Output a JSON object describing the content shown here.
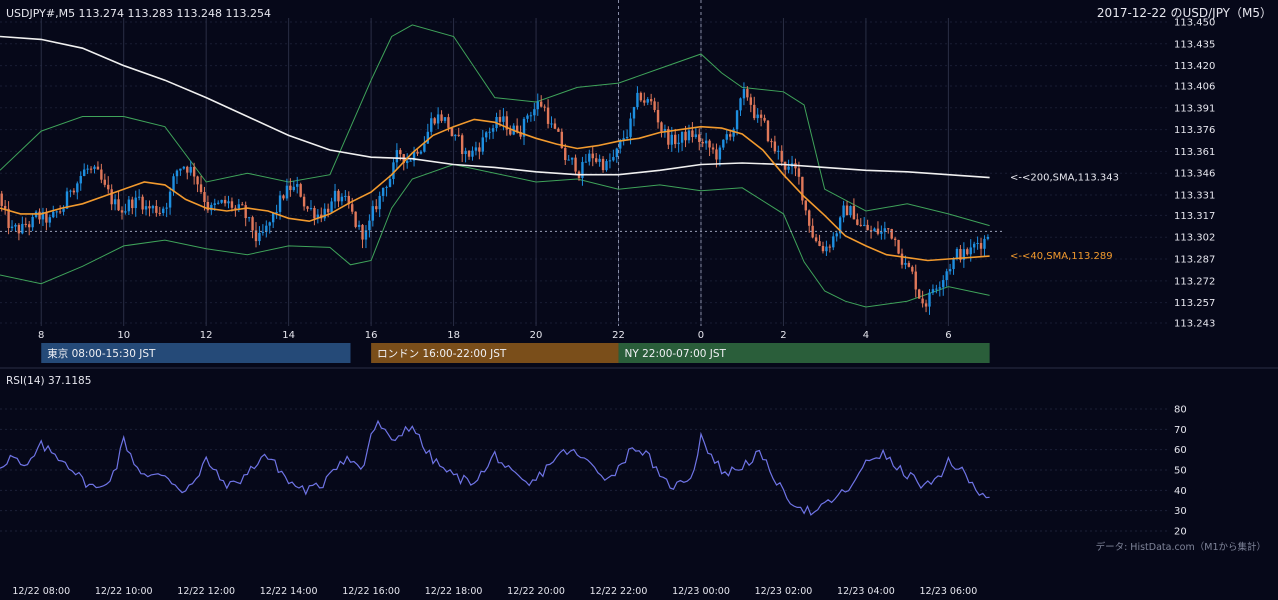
{
  "header": {
    "symbol_line": "USDJPY#,M5 113.274 113.283 113.248 113.254",
    "title": "2017-12-22 のUSD/JPY（M5）"
  },
  "sessions": [
    {
      "label": "東京 08:00-15:30 JST",
      "start_hour": 8,
      "end_hour": 15.5,
      "color": "#254a78"
    },
    {
      "label": "ロンドン 16:00-22:00 JST",
      "start_hour": 16,
      "end_hour": 22,
      "color": "#7a4e1a"
    },
    {
      "label": "NY 22:00-07:00 JST",
      "start_hour": 22,
      "end_hour": 31,
      "color": "#2a5e3a"
    }
  ],
  "rsi_panel": {
    "title": "RSI(14) 37.1185"
  },
  "source_note": "データ: HistData.com（M1から集計）",
  "colors": {
    "background": "#060819",
    "candle_up": "#1e8fe0",
    "candle_down": "#e0785a",
    "sma200": "#f0f0f0",
    "sma40": "#f29a2e",
    "bollinger": "#3fa35a",
    "rsi": "#6f74e6"
  },
  "chart_data": [
    {
      "type": "candlestick",
      "ylim": [
        113.243,
        113.45
      ],
      "y_ticks": [
        "113.450",
        "113.435",
        "113.420",
        "113.406",
        "113.391",
        "113.376",
        "113.361",
        "113.346",
        "113.331",
        "113.317",
        "113.302",
        "113.287",
        "113.272",
        "113.257",
        "113.243"
      ],
      "x_ticks": [
        "8",
        "10",
        "12",
        "14",
        "16",
        "18",
        "20",
        "22",
        "0",
        "2",
        "4",
        "6"
      ],
      "x_tick_hours": [
        8,
        10,
        12,
        14,
        16,
        18,
        20,
        22,
        24,
        26,
        28,
        30
      ],
      "x_range_hours": [
        7,
        31.3
      ],
      "last_close": 113.254,
      "series": [
        {
          "name": "200,SMA",
          "label": "<-<200,SMA,113.343",
          "last": 113.343,
          "points": [
            [
              7,
              113.44
            ],
            [
              8,
              113.438
            ],
            [
              9,
              113.432
            ],
            [
              10,
              113.42
            ],
            [
              11,
              113.41
            ],
            [
              12,
              113.398
            ],
            [
              13,
              113.385
            ],
            [
              14,
              113.372
            ],
            [
              15,
              113.362
            ],
            [
              16,
              113.357
            ],
            [
              17,
              113.356
            ],
            [
              18,
              113.352
            ],
            [
              19,
              113.35
            ],
            [
              20,
              113.347
            ],
            [
              21,
              113.345
            ],
            [
              22,
              113.345
            ],
            [
              23,
              113.348
            ],
            [
              24,
              113.352
            ],
            [
              25,
              113.353
            ],
            [
              26,
              113.352
            ],
            [
              27,
              113.35
            ],
            [
              28,
              113.348
            ],
            [
              29,
              113.347
            ],
            [
              30,
              113.345
            ],
            [
              31,
              113.343
            ]
          ]
        },
        {
          "name": "40,SMA",
          "label": "<-<40,SMA,113.289",
          "last": 113.289,
          "points": [
            [
              7,
              113.322
            ],
            [
              7.5,
              113.318
            ],
            [
              8,
              113.318
            ],
            [
              8.5,
              113.322
            ],
            [
              9,
              113.325
            ],
            [
              9.5,
              113.33
            ],
            [
              10,
              113.335
            ],
            [
              10.5,
              113.34
            ],
            [
              11,
              113.338
            ],
            [
              11.5,
              113.328
            ],
            [
              12,
              113.322
            ],
            [
              12.5,
              113.32
            ],
            [
              13,
              113.322
            ],
            [
              13.5,
              113.32
            ],
            [
              14,
              113.315
            ],
            [
              14.5,
              113.313
            ],
            [
              15,
              113.318
            ],
            [
              15.5,
              113.326
            ],
            [
              16,
              113.333
            ],
            [
              16.5,
              113.345
            ],
            [
              17,
              113.36
            ],
            [
              17.5,
              113.372
            ],
            [
              18,
              113.378
            ],
            [
              18.5,
              113.383
            ],
            [
              19,
              113.381
            ],
            [
              19.5,
              113.375
            ],
            [
              20,
              113.37
            ],
            [
              20.5,
              113.366
            ],
            [
              21,
              113.363
            ],
            [
              21.5,
              113.365
            ],
            [
              22,
              113.368
            ],
            [
              22.5,
              113.37
            ],
            [
              23,
              113.374
            ],
            [
              23.5,
              113.376
            ],
            [
              24,
              113.378
            ],
            [
              24.5,
              113.377
            ],
            [
              25,
              113.373
            ],
            [
              25.5,
              113.362
            ],
            [
              26,
              113.345
            ],
            [
              26.5,
              113.33
            ],
            [
              27,
              113.317
            ],
            [
              27.5,
              113.303
            ],
            [
              28,
              113.296
            ],
            [
              28.5,
              113.29
            ],
            [
              29,
              113.288
            ],
            [
              29.5,
              113.286
            ],
            [
              30,
              113.287
            ],
            [
              30.5,
              113.288
            ],
            [
              31,
              113.289
            ]
          ]
        },
        {
          "name": "Bollinger upper",
          "points": [
            [
              7,
              113.348
            ],
            [
              8,
              113.375
            ],
            [
              9,
              113.385
            ],
            [
              10,
              113.385
            ],
            [
              11,
              113.378
            ],
            [
              12,
              113.34
            ],
            [
              13,
              113.346
            ],
            [
              14,
              113.34
            ],
            [
              15,
              113.345
            ],
            [
              16,
              113.41
            ],
            [
              16.5,
              113.44
            ],
            [
              17,
              113.448
            ],
            [
              18,
              113.44
            ],
            [
              19,
              113.398
            ],
            [
              20,
              113.395
            ],
            [
              21,
              113.405
            ],
            [
              22,
              113.408
            ],
            [
              23,
              113.418
            ],
            [
              24,
              113.428
            ],
            [
              24.5,
              113.415
            ],
            [
              25,
              113.405
            ],
            [
              26,
              113.402
            ],
            [
              26.5,
              113.393
            ],
            [
              27,
              113.335
            ],
            [
              28,
              113.32
            ],
            [
              29,
              113.325
            ],
            [
              30,
              113.318
            ],
            [
              31,
              113.31
            ]
          ]
        },
        {
          "name": "Bollinger lower",
          "points": [
            [
              7,
              113.276
            ],
            [
              8,
              113.27
            ],
            [
              9,
              113.282
            ],
            [
              10,
              113.296
            ],
            [
              11,
              113.3
            ],
            [
              12,
              113.294
            ],
            [
              13,
              113.29
            ],
            [
              14,
              113.296
            ],
            [
              15,
              113.295
            ],
            [
              15.5,
              113.283
            ],
            [
              16,
              113.286
            ],
            [
              16.5,
              113.322
            ],
            [
              17,
              113.342
            ],
            [
              18,
              113.352
            ],
            [
              19,
              113.346
            ],
            [
              20,
              113.34
            ],
            [
              21,
              113.342
            ],
            [
              22,
              113.335
            ],
            [
              23,
              113.338
            ],
            [
              24,
              113.334
            ],
            [
              25,
              113.336
            ],
            [
              26,
              113.318
            ],
            [
              26.5,
              113.285
            ],
            [
              27,
              113.265
            ],
            [
              27.5,
              113.258
            ],
            [
              28,
              113.254
            ],
            [
              29,
              113.258
            ],
            [
              30,
              113.268
            ],
            [
              31,
              113.262
            ]
          ]
        }
      ]
    },
    {
      "type": "line",
      "title": "RSI(14) 37.1185",
      "ylim": [
        20,
        80
      ],
      "y_ticks": [
        20,
        30,
        40,
        50,
        60,
        70,
        80
      ],
      "x_ticks": [
        "12/22 08:00",
        "12/22 10:00",
        "12/22 12:00",
        "12/22 14:00",
        "12/22 16:00",
        "12/22 18:00",
        "12/22 20:00",
        "12/22 22:00",
        "12/23 00:00",
        "12/23 02:00",
        "12/23 04:00",
        "12/23 06:00"
      ],
      "x_tick_hours": [
        8,
        10,
        12,
        14,
        16,
        18,
        20,
        22,
        24,
        26,
        28,
        30
      ],
      "series": [
        {
          "name": "RSI(14)",
          "last": 37.1185,
          "points": [
            [
              7,
              52
            ],
            [
              7.3,
              57
            ],
            [
              7.6,
              50
            ],
            [
              8,
              62
            ],
            [
              8.3,
              58
            ],
            [
              8.6,
              54
            ],
            [
              9,
              45
            ],
            [
              9.4,
              40
            ],
            [
              9.8,
              50
            ],
            [
              10,
              65
            ],
            [
              10.3,
              52
            ],
            [
              10.6,
              46
            ],
            [
              11,
              48
            ],
            [
              11.4,
              40
            ],
            [
              11.8,
              45
            ],
            [
              12,
              56
            ],
            [
              12.3,
              46
            ],
            [
              12.6,
              42
            ],
            [
              13,
              48
            ],
            [
              13.4,
              58
            ],
            [
              13.8,
              50
            ],
            [
              14,
              44
            ],
            [
              14.4,
              40
            ],
            [
              14.8,
              42
            ],
            [
              15,
              50
            ],
            [
              15.4,
              56
            ],
            [
              15.8,
              50
            ],
            [
              16,
              68
            ],
            [
              16.2,
              73
            ],
            [
              16.5,
              63
            ],
            [
              16.8,
              70
            ],
            [
              17,
              72
            ],
            [
              17.3,
              60
            ],
            [
              17.6,
              53
            ],
            [
              18,
              47
            ],
            [
              18.4,
              44
            ],
            [
              18.8,
              50
            ],
            [
              19,
              58
            ],
            [
              19.4,
              48
            ],
            [
              19.8,
              42
            ],
            [
              20,
              45
            ],
            [
              20.4,
              55
            ],
            [
              20.8,
              60
            ],
            [
              21,
              57
            ],
            [
              21.4,
              52
            ],
            [
              21.8,
              45
            ],
            [
              22,
              52
            ],
            [
              22.4,
              62
            ],
            [
              22.8,
              55
            ],
            [
              23,
              45
            ],
            [
              23.4,
              42
            ],
            [
              23.8,
              48
            ],
            [
              24,
              67
            ],
            [
              24.3,
              55
            ],
            [
              24.6,
              48
            ],
            [
              25,
              52
            ],
            [
              25.4,
              58
            ],
            [
              25.8,
              46
            ],
            [
              26,
              38
            ],
            [
              26.4,
              32
            ],
            [
              26.8,
              28
            ],
            [
              27,
              33
            ],
            [
              27.4,
              38
            ],
            [
              27.8,
              45
            ],
            [
              28,
              55
            ],
            [
              28.4,
              58
            ],
            [
              28.8,
              50
            ],
            [
              29,
              48
            ],
            [
              29.4,
              42
            ],
            [
              29.8,
              45
            ],
            [
              30,
              55
            ],
            [
              30.3,
              50
            ],
            [
              30.6,
              42
            ],
            [
              31,
              37
            ]
          ]
        }
      ]
    }
  ]
}
